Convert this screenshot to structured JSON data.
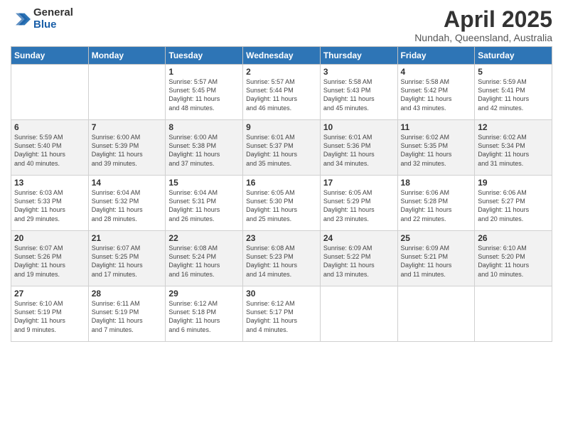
{
  "logo": {
    "general": "General",
    "blue": "Blue"
  },
  "title": "April 2025",
  "location": "Nundah, Queensland, Australia",
  "weekdays": [
    "Sunday",
    "Monday",
    "Tuesday",
    "Wednesday",
    "Thursday",
    "Friday",
    "Saturday"
  ],
  "weeks": [
    [
      {
        "day": "",
        "info": ""
      },
      {
        "day": "",
        "info": ""
      },
      {
        "day": "1",
        "info": "Sunrise: 5:57 AM\nSunset: 5:45 PM\nDaylight: 11 hours\nand 48 minutes."
      },
      {
        "day": "2",
        "info": "Sunrise: 5:57 AM\nSunset: 5:44 PM\nDaylight: 11 hours\nand 46 minutes."
      },
      {
        "day": "3",
        "info": "Sunrise: 5:58 AM\nSunset: 5:43 PM\nDaylight: 11 hours\nand 45 minutes."
      },
      {
        "day": "4",
        "info": "Sunrise: 5:58 AM\nSunset: 5:42 PM\nDaylight: 11 hours\nand 43 minutes."
      },
      {
        "day": "5",
        "info": "Sunrise: 5:59 AM\nSunset: 5:41 PM\nDaylight: 11 hours\nand 42 minutes."
      }
    ],
    [
      {
        "day": "6",
        "info": "Sunrise: 5:59 AM\nSunset: 5:40 PM\nDaylight: 11 hours\nand 40 minutes."
      },
      {
        "day": "7",
        "info": "Sunrise: 6:00 AM\nSunset: 5:39 PM\nDaylight: 11 hours\nand 39 minutes."
      },
      {
        "day": "8",
        "info": "Sunrise: 6:00 AM\nSunset: 5:38 PM\nDaylight: 11 hours\nand 37 minutes."
      },
      {
        "day": "9",
        "info": "Sunrise: 6:01 AM\nSunset: 5:37 PM\nDaylight: 11 hours\nand 35 minutes."
      },
      {
        "day": "10",
        "info": "Sunrise: 6:01 AM\nSunset: 5:36 PM\nDaylight: 11 hours\nand 34 minutes."
      },
      {
        "day": "11",
        "info": "Sunrise: 6:02 AM\nSunset: 5:35 PM\nDaylight: 11 hours\nand 32 minutes."
      },
      {
        "day": "12",
        "info": "Sunrise: 6:02 AM\nSunset: 5:34 PM\nDaylight: 11 hours\nand 31 minutes."
      }
    ],
    [
      {
        "day": "13",
        "info": "Sunrise: 6:03 AM\nSunset: 5:33 PM\nDaylight: 11 hours\nand 29 minutes."
      },
      {
        "day": "14",
        "info": "Sunrise: 6:04 AM\nSunset: 5:32 PM\nDaylight: 11 hours\nand 28 minutes."
      },
      {
        "day": "15",
        "info": "Sunrise: 6:04 AM\nSunset: 5:31 PM\nDaylight: 11 hours\nand 26 minutes."
      },
      {
        "day": "16",
        "info": "Sunrise: 6:05 AM\nSunset: 5:30 PM\nDaylight: 11 hours\nand 25 minutes."
      },
      {
        "day": "17",
        "info": "Sunrise: 6:05 AM\nSunset: 5:29 PM\nDaylight: 11 hours\nand 23 minutes."
      },
      {
        "day": "18",
        "info": "Sunrise: 6:06 AM\nSunset: 5:28 PM\nDaylight: 11 hours\nand 22 minutes."
      },
      {
        "day": "19",
        "info": "Sunrise: 6:06 AM\nSunset: 5:27 PM\nDaylight: 11 hours\nand 20 minutes."
      }
    ],
    [
      {
        "day": "20",
        "info": "Sunrise: 6:07 AM\nSunset: 5:26 PM\nDaylight: 11 hours\nand 19 minutes."
      },
      {
        "day": "21",
        "info": "Sunrise: 6:07 AM\nSunset: 5:25 PM\nDaylight: 11 hours\nand 17 minutes."
      },
      {
        "day": "22",
        "info": "Sunrise: 6:08 AM\nSunset: 5:24 PM\nDaylight: 11 hours\nand 16 minutes."
      },
      {
        "day": "23",
        "info": "Sunrise: 6:08 AM\nSunset: 5:23 PM\nDaylight: 11 hours\nand 14 minutes."
      },
      {
        "day": "24",
        "info": "Sunrise: 6:09 AM\nSunset: 5:22 PM\nDaylight: 11 hours\nand 13 minutes."
      },
      {
        "day": "25",
        "info": "Sunrise: 6:09 AM\nSunset: 5:21 PM\nDaylight: 11 hours\nand 11 minutes."
      },
      {
        "day": "26",
        "info": "Sunrise: 6:10 AM\nSunset: 5:20 PM\nDaylight: 11 hours\nand 10 minutes."
      }
    ],
    [
      {
        "day": "27",
        "info": "Sunrise: 6:10 AM\nSunset: 5:19 PM\nDaylight: 11 hours\nand 9 minutes."
      },
      {
        "day": "28",
        "info": "Sunrise: 6:11 AM\nSunset: 5:19 PM\nDaylight: 11 hours\nand 7 minutes."
      },
      {
        "day": "29",
        "info": "Sunrise: 6:12 AM\nSunset: 5:18 PM\nDaylight: 11 hours\nand 6 minutes."
      },
      {
        "day": "30",
        "info": "Sunrise: 6:12 AM\nSunset: 5:17 PM\nDaylight: 11 hours\nand 4 minutes."
      },
      {
        "day": "",
        "info": ""
      },
      {
        "day": "",
        "info": ""
      },
      {
        "day": "",
        "info": ""
      }
    ]
  ]
}
